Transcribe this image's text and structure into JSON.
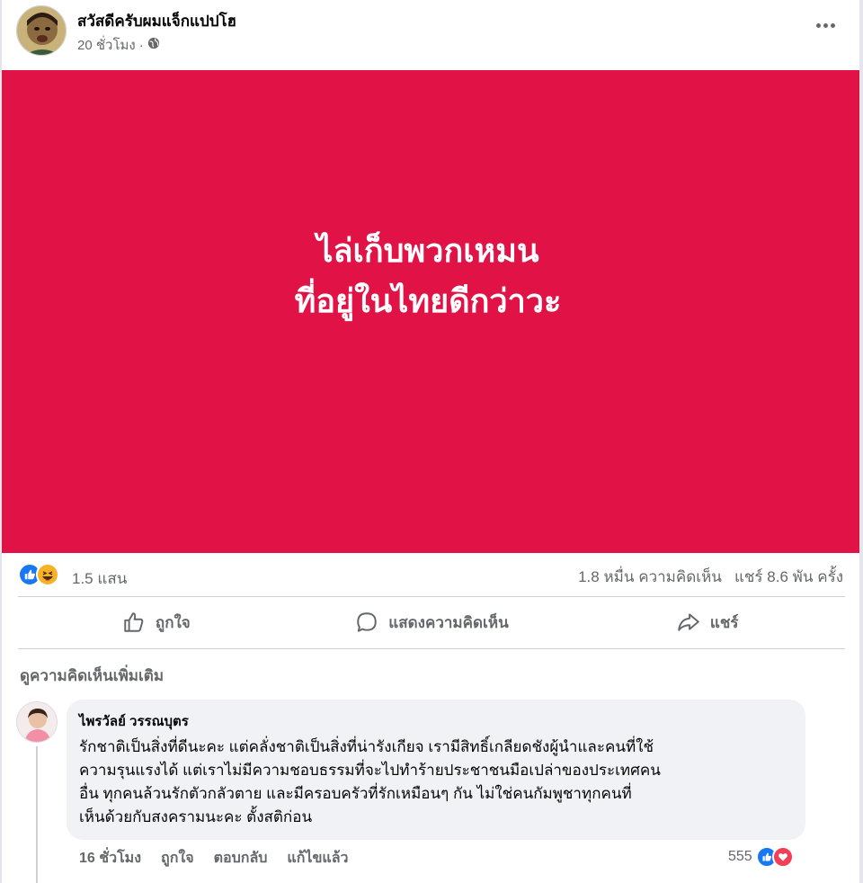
{
  "post": {
    "author": "สวัสดีครับผมแจ็กแปปโฮ",
    "timestamp": "20 ชั่วโมง",
    "separator": "·",
    "privacy_icon": "globe-icon",
    "more_icon": "more-horizontal-icon"
  },
  "banner": {
    "background": "#e11246",
    "line1": "ไล่เก็บพวกเหมน",
    "line2": "ที่อยู่ในไทยดีกว่าวะ"
  },
  "stats": {
    "reaction_icons": [
      "like-icon",
      "haha-icon"
    ],
    "reaction_count": "1.5 แสน",
    "comments": "1.8 หมื่น ความคิดเห็น",
    "shares": "แชร์ 8.6 พัน ครั้ง"
  },
  "actions": {
    "like": "ถูกใจ",
    "comment": "แสดงความคิดเห็น",
    "share": "แชร์"
  },
  "more_comments": "ดูความคิดเห็นเพิ่มเติม",
  "comment": {
    "author": "ไพรวัลย์ วรรณบุตร",
    "lines": [
      "รักชาติเป็นสิ่งที่ดีนะคะ แต่คลั่งชาติเป็นสิ่งที่น่ารังเกียจ  เรามีสิทธิ์เกลียดชังผู้นำและคนที่ใช้",
      "ความรุนแรงได้  แต่เราไม่มีความชอบธรรมที่จะไปทำร้ายประชาชนมือเปล่าของประเทศคน",
      "อื่น ทุกคนล้วนรักตัวกลัวตาย  และมีครอบครัวที่รักเหมือนๆ กัน ไม่ใช่คนกัมพูชาทุกคนที่",
      "เห็นด้วยกับสงครามนะคะ  ตั้งสติก่อน"
    ],
    "time": "16 ชั่วโมง",
    "like": "ถูกใจ",
    "reply": "ตอบกลับ",
    "edited": "แก้ไขแล้ว",
    "reaction_count": "555",
    "reaction_icons": [
      "like-icon",
      "love-icon"
    ]
  }
}
